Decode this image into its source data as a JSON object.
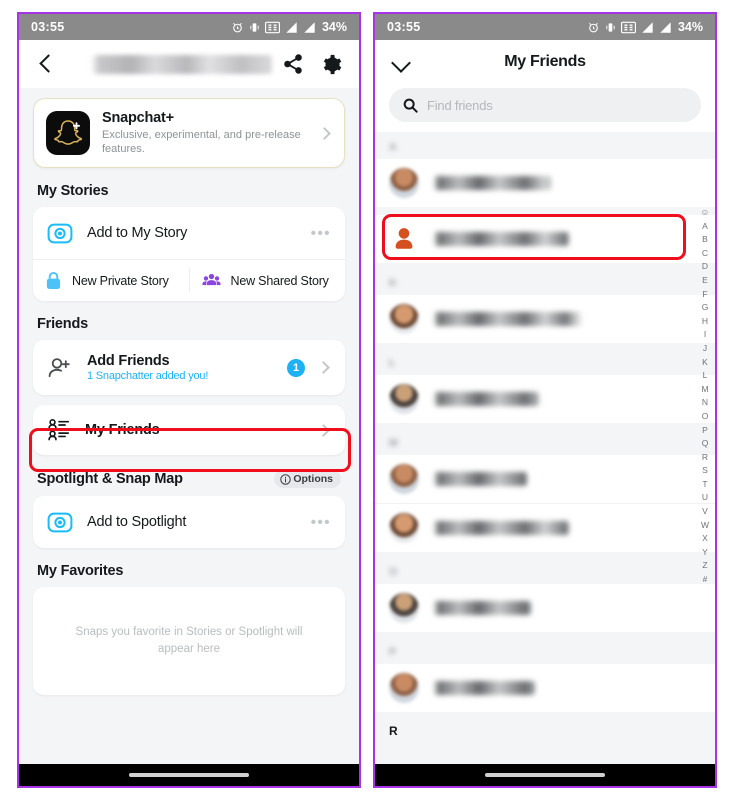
{
  "status_bar": {
    "time": "03:55",
    "battery": "34%",
    "icons": [
      "alarm-icon",
      "vibrate-icon",
      "sim-icon",
      "signal-bar-icon",
      "signal-bar-icon"
    ]
  },
  "left_panel": {
    "header": {
      "back_icon": "back-chevron-icon",
      "username": "",
      "share_icon": "share-icon",
      "settings_icon": "gear-icon"
    },
    "snapchat_plus": {
      "title": "Snapchat+",
      "subtitle": "Exclusive, experimental, and pre-release features.",
      "logo_icon": "snapchat-plus-ghost-icon",
      "chevron": "chevron-right-icon"
    },
    "sections": {
      "my_stories": {
        "title": "My Stories",
        "add_to_my_story": {
          "label": "Add to My Story",
          "icon": "camera-circle-icon",
          "more": "•••"
        },
        "new_private_story": {
          "label": "New Private Story",
          "icon": "lock-icon"
        },
        "new_shared_story": {
          "label": "New Shared Story",
          "icon": "group-people-icon"
        }
      },
      "friends": {
        "title": "Friends",
        "add_friends": {
          "label": "Add Friends",
          "sublabel": "1 Snapchatter added you!",
          "badge": "1",
          "icon": "add-person-icon"
        },
        "my_friends": {
          "label": "My Friends",
          "icon": "friends-list-icon"
        }
      },
      "spotlight_snap_map": {
        "title": "Spotlight & Snap Map",
        "options_label": "Options",
        "options_icon": "info-circle-icon",
        "add_to_spotlight": {
          "label": "Add to Spotlight",
          "icon": "camera-circle-icon",
          "more": "•••"
        }
      },
      "my_favorites": {
        "title": "My Favorites",
        "empty_text": "Snaps you favorite in Stories or Spotlight will appear here"
      }
    }
  },
  "right_panel": {
    "header": {
      "collapse_icon": "chevron-down-icon",
      "title": "My Friends"
    },
    "search": {
      "placeholder": "Find friends",
      "icon": "search-icon",
      "value": ""
    },
    "groups": [
      {
        "letter": "A",
        "blurred": true,
        "friends": [
          {
            "name": "",
            "avatar": "bitmoji-avatar",
            "highlighted": false
          },
          {
            "name": "",
            "avatar": "orange-person-avatar",
            "highlighted": true
          }
        ]
      },
      {
        "letter": "K",
        "blurred": true,
        "friends": [
          {
            "name": "",
            "avatar": "bitmoji-avatar",
            "highlighted": false
          }
        ]
      },
      {
        "letter": "L",
        "blurred": true,
        "friends": [
          {
            "name": "",
            "avatar": "bitmoji-avatar",
            "highlighted": false
          }
        ]
      },
      {
        "letter": "M",
        "blurred": true,
        "friends": [
          {
            "name": "",
            "avatar": "bitmoji-avatar",
            "highlighted": false
          },
          {
            "name": "",
            "avatar": "bitmoji-avatar",
            "highlighted": false
          }
        ]
      },
      {
        "letter": "O",
        "blurred": true,
        "friends": [
          {
            "name": "",
            "avatar": "bitmoji-avatar",
            "highlighted": false
          }
        ]
      },
      {
        "letter": "P",
        "blurred": true,
        "friends": [
          {
            "name": "",
            "avatar": "bitmoji-avatar",
            "highlighted": false
          }
        ]
      },
      {
        "letter": "R",
        "blurred": false,
        "friends": []
      }
    ],
    "alpha_index": [
      "☺",
      "A",
      "B",
      "C",
      "D",
      "E",
      "F",
      "G",
      "H",
      "I",
      "J",
      "K",
      "L",
      "M",
      "N",
      "O",
      "P",
      "Q",
      "R",
      "S",
      "T",
      "U",
      "V",
      "W",
      "X",
      "Y",
      "Z",
      "#"
    ]
  },
  "colors": {
    "accent_blue": "#1fb1f5",
    "highlight_red": "#f00d1c",
    "frame_purple": "#a734e8",
    "gold": "#d4af37",
    "purple_story": "#8a4ddb",
    "orange_avatar": "#d4501e"
  }
}
